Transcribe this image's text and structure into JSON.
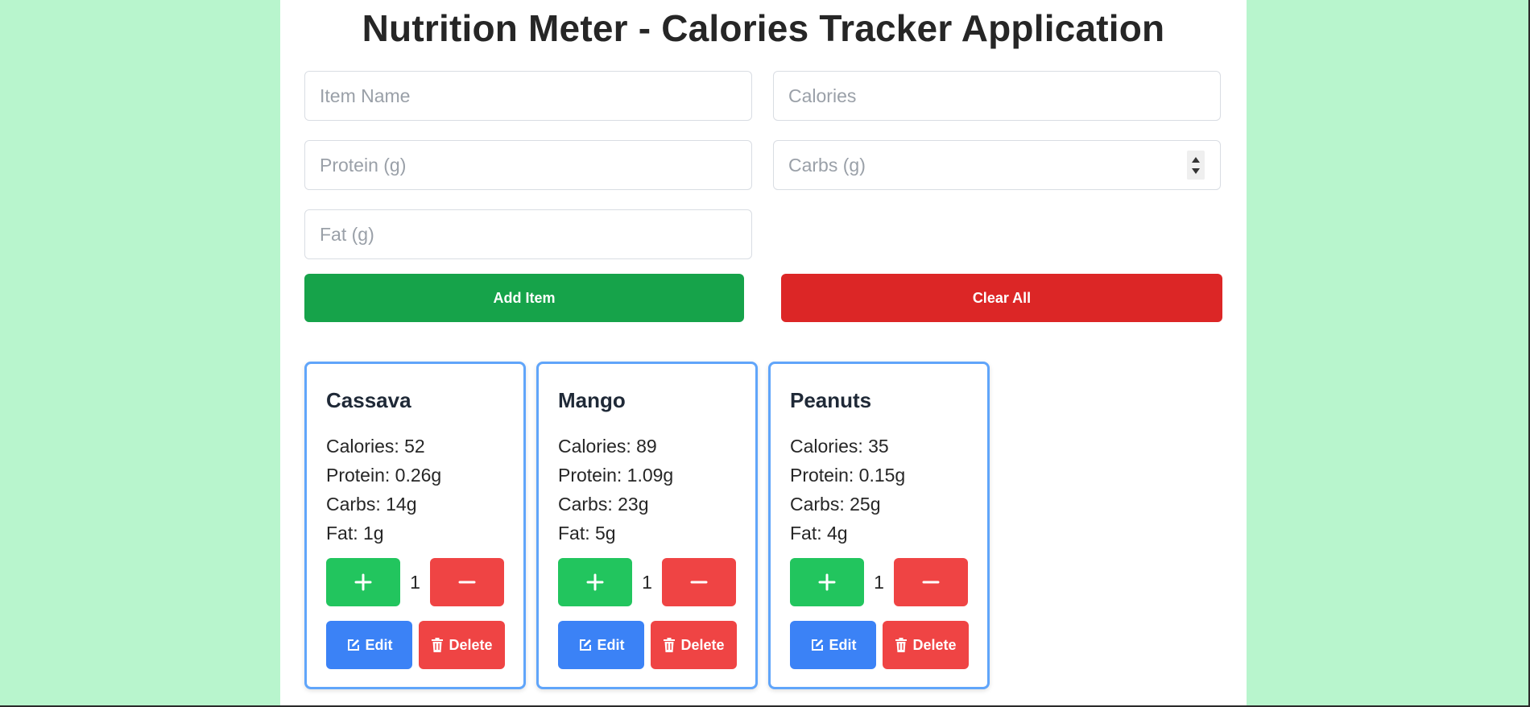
{
  "page": {
    "title": "Nutrition Meter - Calories Tracker Application"
  },
  "form": {
    "item_name_placeholder": "Item Name",
    "calories_placeholder": "Calories",
    "protein_placeholder": "Protein (g)",
    "carbs_placeholder": "Carbs (g)",
    "fat_placeholder": "Fat (g)",
    "add_label": "Add Item",
    "clear_label": "Clear All"
  },
  "items": [
    {
      "name": "Cassava",
      "calories": "Calories: 52",
      "protein": "Protein: 0.26g",
      "carbs": "Carbs: 14g",
      "fat": "Fat: 1g",
      "quantity": "1",
      "edit_label": "Edit",
      "delete_label": "Delete"
    },
    {
      "name": "Mango",
      "calories": "Calories: 89",
      "protein": "Protein: 1.09g",
      "carbs": "Carbs: 23g",
      "fat": "Fat: 5g",
      "quantity": "1",
      "edit_label": "Edit",
      "delete_label": "Delete"
    },
    {
      "name": "Peanuts",
      "calories": "Calories: 35",
      "protein": "Protein: 0.15g",
      "carbs": "Carbs: 25g",
      "fat": "Fat: 4g",
      "quantity": "1",
      "edit_label": "Edit",
      "delete_label": "Delete"
    }
  ],
  "colors": {
    "page_background": "#b8f5cd",
    "add_button": "#16a34a",
    "clear_button": "#dc2626",
    "increment_button": "#22c55e",
    "decrement_button": "#ef4444",
    "edit_button": "#3b82f6",
    "delete_button": "#ef4444",
    "card_border": "#60a5fa"
  }
}
